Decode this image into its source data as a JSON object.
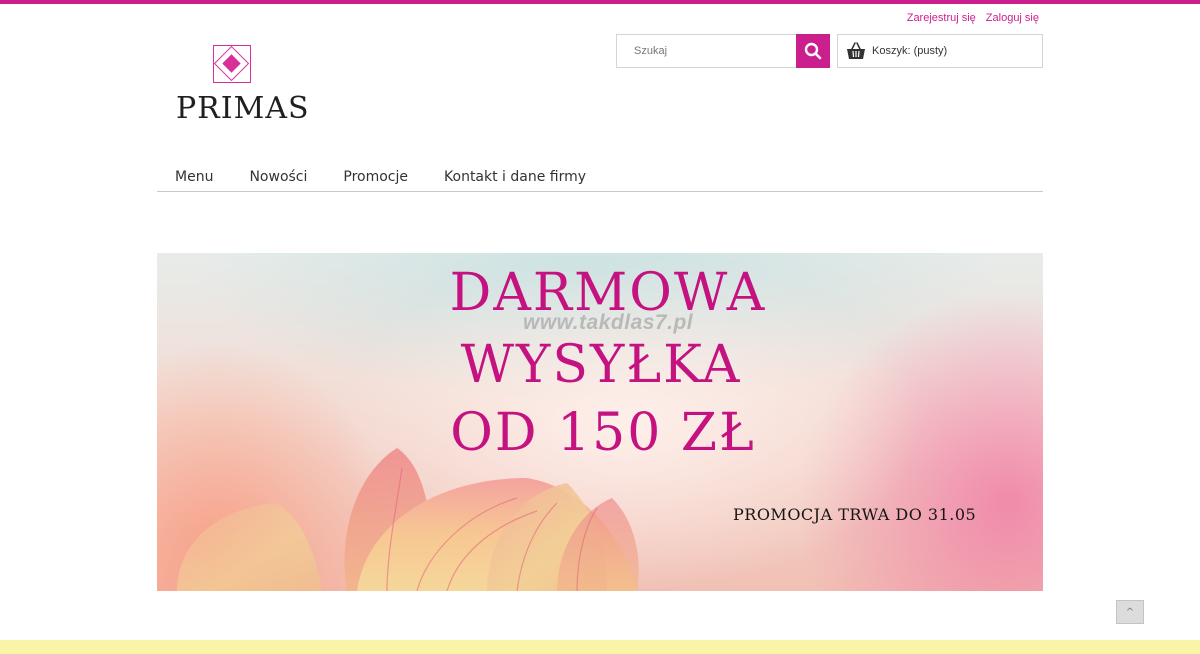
{
  "header": {
    "register_link": "Zarejestruj się",
    "login_link": "Zaloguj się",
    "logo_text": "PRIMAS",
    "search": {
      "placeholder": "Szukaj"
    },
    "cart": {
      "label": "Koszyk: (pusty)"
    }
  },
  "nav": {
    "items": [
      {
        "label": "Menu"
      },
      {
        "label": "Nowości"
      },
      {
        "label": "Promocje"
      },
      {
        "label": "Kontakt i dane firmy"
      }
    ]
  },
  "banner": {
    "line1": "DARMOWA",
    "line2": "WYSYŁKA",
    "line3": "OD 150 ZŁ",
    "promo_text": "PROMOCJA TRWA DO 31.05",
    "watermark": "www.takdlas7.pl"
  },
  "footer": {
    "to_top_label": "^"
  },
  "colors": {
    "accent": "#cc1f8e",
    "footer_band": "#f9f4a8"
  }
}
